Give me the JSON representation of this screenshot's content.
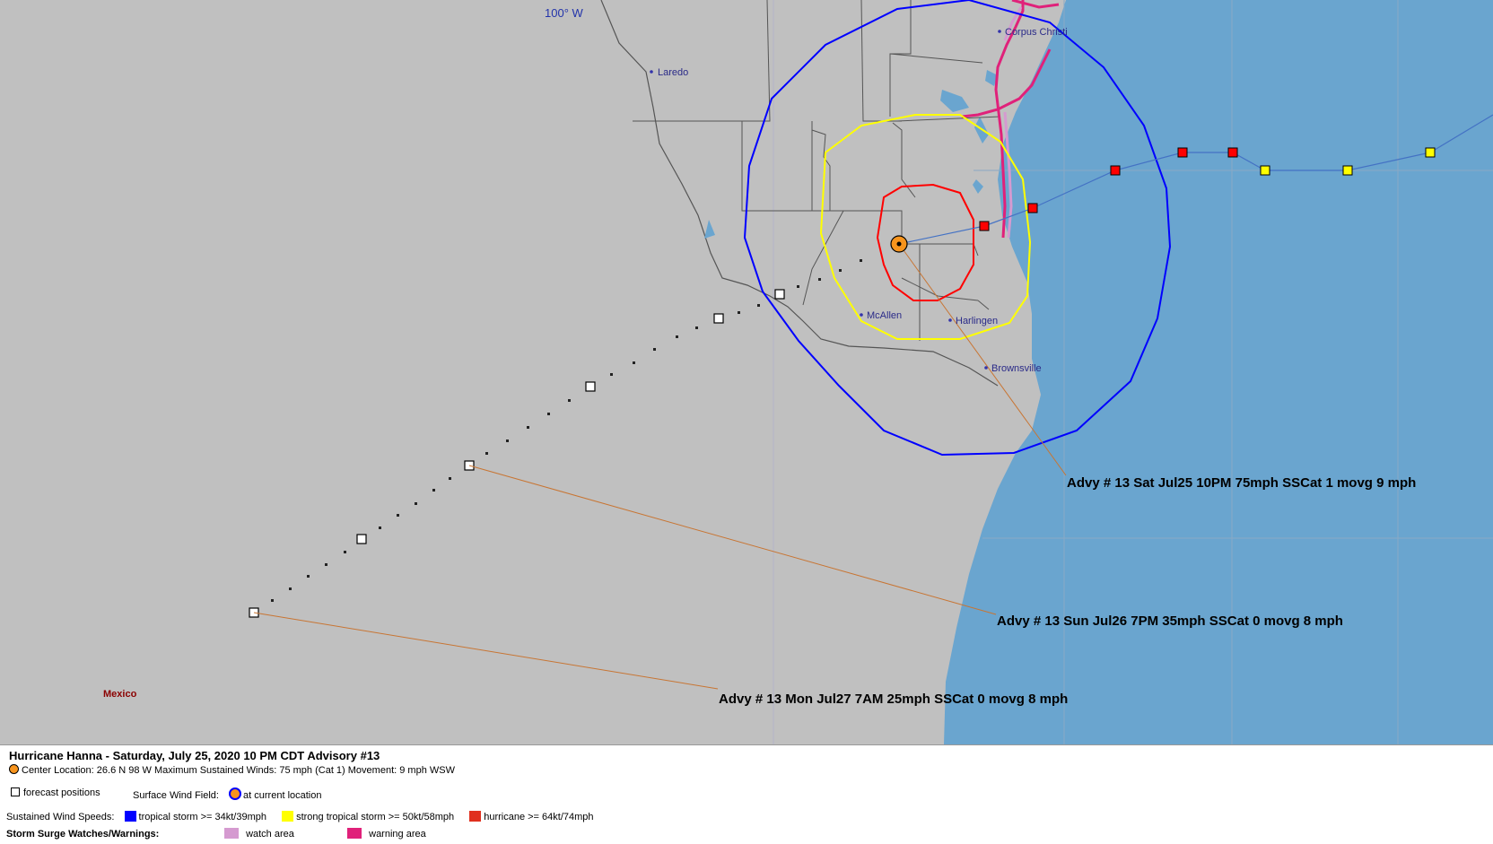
{
  "map": {
    "meridian_label": "100° W",
    "cities": [
      {
        "id": "laredo",
        "name": "Laredo"
      },
      {
        "id": "corpus-christi",
        "name": "Corpus Christi"
      },
      {
        "id": "mcallen",
        "name": "McAllen"
      },
      {
        "id": "harlingen",
        "name": "Harlingen"
      },
      {
        "id": "brownsville",
        "name": "Brownsville"
      }
    ],
    "country_label": "Mexico",
    "callouts": [
      {
        "id": "current",
        "text": "Advy # 13 Sat Jul25 10PM  75mph SSCat 1 movg 9 mph"
      },
      {
        "id": "jul26",
        "text": "Advy # 13 Sun Jul26 7PM  35mph SSCat 0 movg 8 mph"
      },
      {
        "id": "jul27",
        "text": "Advy # 13 Mon Jul27 7AM  25mph SSCat 0 movg 8 mph"
      }
    ],
    "colors": {
      "land": "#c0c0c0",
      "water": "#6aa5cf",
      "tropical_storm": "#0000ff",
      "strong_tropical_storm": "#ffff00",
      "hurricane": "#ff0000",
      "storm_center": "#f7941d",
      "callout_line": "#c87533",
      "track": "#4472c4",
      "warning_area": "#e0217a",
      "watch_area": "#d59ad0"
    }
  },
  "legend": {
    "title": "Hurricane Hanna  -  Saturday, July 25, 2020  10 PM CDT   Advisory #13",
    "center_line": "Center Location: 26.6 N  98 W   Maximum Sustained Winds: 75 mph (Cat 1) Movement: 9 mph WSW",
    "forecast_positions": "forecast positions",
    "surface_wind_field_label": "Surface Wind Field:",
    "at_current_location": "at current location",
    "sustained_label": "Sustained Wind Speeds:",
    "ts_label": "tropical storm >= 34kt/39mph",
    "sts_label": "strong tropical storm >= 50kt/58mph",
    "hu_label": "hurricane >= 64kt/74mph",
    "surge_label": "Storm Surge Watches/Warnings:",
    "watch_label": "watch area",
    "warning_label": "warning area"
  }
}
